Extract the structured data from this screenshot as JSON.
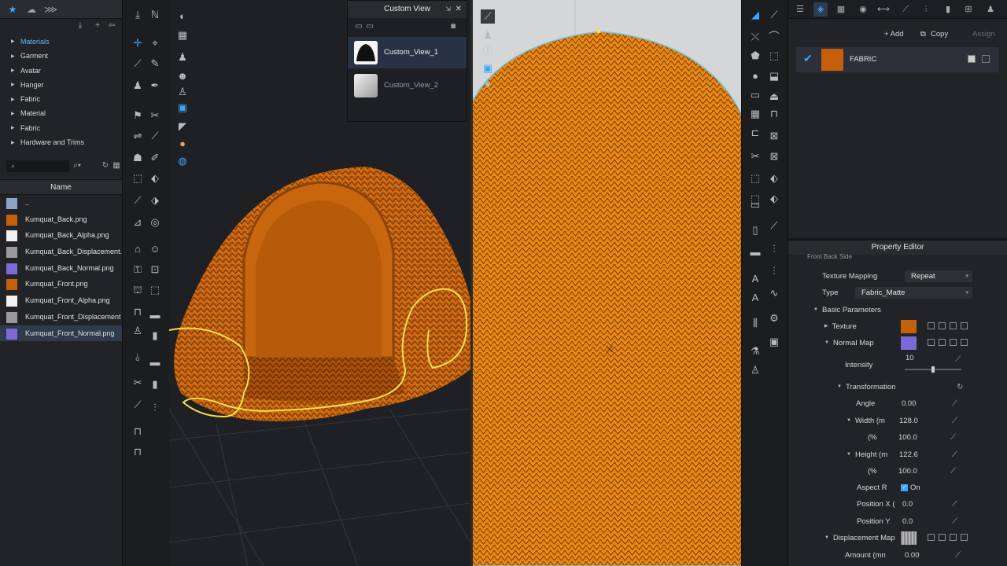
{
  "library": {
    "tree": [
      {
        "label": "Materials",
        "active": true
      },
      {
        "label": "Garment"
      },
      {
        "label": "Avatar"
      },
      {
        "label": "Hanger"
      },
      {
        "label": "Fabric"
      },
      {
        "label": "Material"
      },
      {
        "label": "Fabric"
      },
      {
        "label": "Hardware and Trims"
      }
    ],
    "search": {
      "value": ""
    },
    "column_header": "Name",
    "files": [
      {
        "name": "..",
        "color": "#8aa4c4"
      },
      {
        "name": "Kumquat_Back.png",
        "color": "#c65f0c"
      },
      {
        "name": "Kumquat_Back_Alpha.png",
        "color": "#f0f0f0"
      },
      {
        "name": "Kumquat_Back_Displacement.",
        "color": "#9a9a9a"
      },
      {
        "name": "Kumquat_Back_Normal.png",
        "color": "#7b6ad6"
      },
      {
        "name": "Kumquat_Front.png",
        "color": "#c65f0c"
      },
      {
        "name": "Kumquat_Front_Alpha.png",
        "color": "#f0f0f0"
      },
      {
        "name": "Kumquat_Front_Displacement",
        "color": "#9a9a9a"
      },
      {
        "name": "Kumquat_Front_Normal.png",
        "color": "#7b6ad6",
        "selected": true
      }
    ]
  },
  "custom_view": {
    "title": "Custom View",
    "items": [
      {
        "label": "Custom_View_1",
        "selected": true
      },
      {
        "label": "Custom_View_2"
      }
    ]
  },
  "object_browser": {
    "add_label": "+ Add",
    "copy_label": "Copy",
    "assign_label": "Assign",
    "fabric_name": "FABRIC",
    "fabric_color": "#c65f0c"
  },
  "property_editor": {
    "title": "Property Editor",
    "subtabs": "Front    Back    Side",
    "texture_mapping_label": "Texture Mapping",
    "texture_mapping_value": "Repeat",
    "type_label": "Type",
    "type_value": "Fabric_Matte",
    "basic_parameters": "Basic Parameters",
    "texture_label": "Texture",
    "normal_map_label": "Normal Map",
    "intensity_label": "Intensity",
    "intensity_value": "10",
    "intensity_fraction": 0.5,
    "transformation_label": "Transformation",
    "angle_label": "Angle",
    "angle_value": "0.00",
    "width_label": "Width (m",
    "width_value": "128.0",
    "width_pct_label": "(%",
    "width_pct_value": "100.0",
    "height_label": "Height (m",
    "height_value": "122.6",
    "height_pct_label": "(%",
    "height_pct_value": "100.0",
    "aspect_label": "Aspect R",
    "aspect_value": "On",
    "posx_label": "Position X (",
    "posx_value": "0.0",
    "posy_label": "Position Y",
    "posy_value": "0.0",
    "displacement_label": "Displacement Map",
    "amount_label": "Amount (mn",
    "amount_value": "0.00"
  },
  "colors": {
    "accent": "#3aa7ff",
    "fabric_orange": "#c65f0c",
    "normal_purple": "#7b6ad6",
    "pattern_outline": "#f1e24a"
  }
}
